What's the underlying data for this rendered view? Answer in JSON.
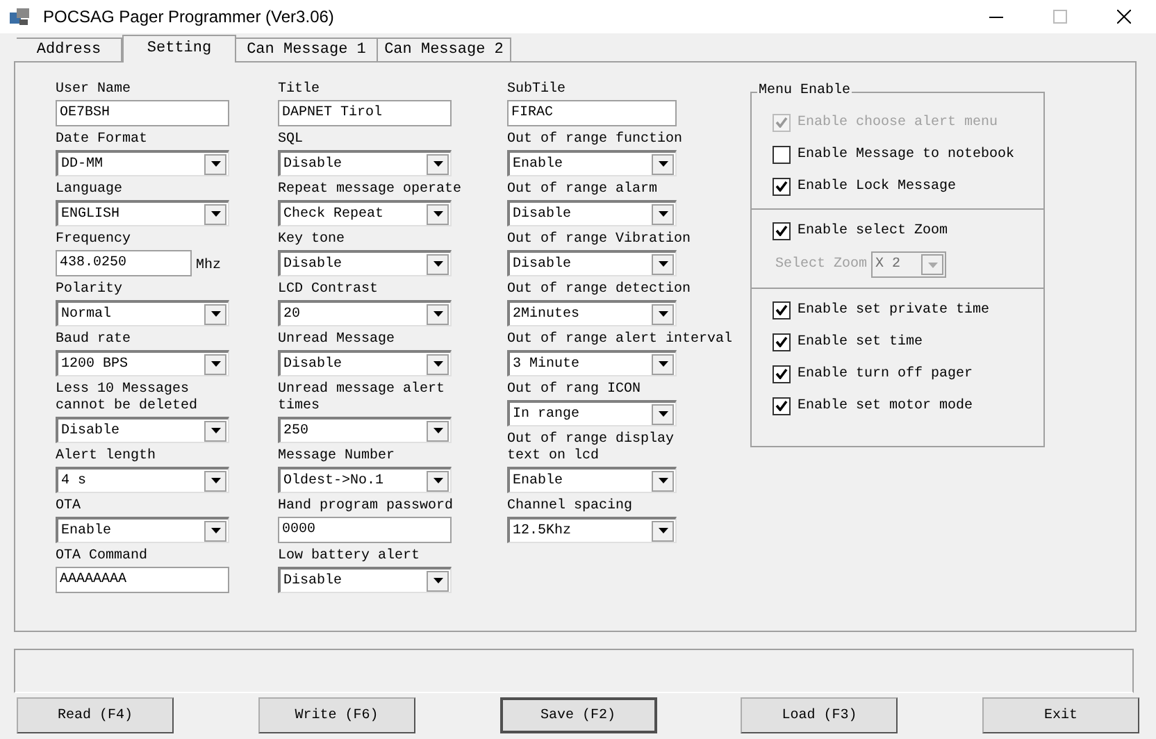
{
  "window": {
    "title": "POCSAG Pager Programmer (Ver3.06)"
  },
  "tabs": [
    {
      "label": "Address",
      "selected": false
    },
    {
      "label": "Setting",
      "selected": true
    },
    {
      "label": "Can Message 1",
      "selected": false
    },
    {
      "label": "Can Message 2",
      "selected": false
    }
  ],
  "columns": [
    {
      "fields": [
        {
          "label": "User Name",
          "kind": "text",
          "value": "OE7BSH"
        },
        {
          "label": "Date Format",
          "kind": "select",
          "value": "DD-MM"
        },
        {
          "label": "Language",
          "kind": "select",
          "value": "ENGLISH"
        },
        {
          "label": "Frequency",
          "kind": "text",
          "value": "438.0250",
          "unit": "Mhz"
        },
        {
          "label": "Polarity",
          "kind": "select",
          "value": "Normal"
        },
        {
          "label": "Baud rate",
          "kind": "select",
          "value": "1200 BPS"
        },
        {
          "label": "Less 10 Messages cannot be deleted",
          "kind": "select",
          "value": "Disable"
        },
        {
          "label": "Alert length",
          "kind": "select",
          "value": "4 s"
        },
        {
          "label": "OTA",
          "kind": "select",
          "value": "Enable"
        },
        {
          "label": "OTA Command",
          "kind": "text",
          "value": "AAAAAAAA"
        }
      ]
    },
    {
      "fields": [
        {
          "label": "Title",
          "kind": "text",
          "value": "DAPNET Tirol"
        },
        {
          "label": "SQL",
          "kind": "select",
          "value": "Disable"
        },
        {
          "label": "Repeat message operate",
          "kind": "select",
          "value": "Check Repeat"
        },
        {
          "label": "Key tone",
          "kind": "select",
          "value": "Disable"
        },
        {
          "label": "LCD Contrast",
          "kind": "select",
          "value": "20"
        },
        {
          "label": "Unread Message",
          "kind": "select",
          "value": "Disable"
        },
        {
          "label": "Unread message alert times",
          "kind": "select",
          "value": "250"
        },
        {
          "label": "Message Number",
          "kind": "select",
          "value": "Oldest->No.1"
        },
        {
          "label": "Hand program password",
          "kind": "text",
          "value": "0000"
        },
        {
          "label": "Low battery alert",
          "kind": "select",
          "value": "Disable"
        }
      ]
    },
    {
      "fields": [
        {
          "label": "SubTile",
          "kind": "text",
          "value": "FIRAC"
        },
        {
          "label": "Out of range function",
          "kind": "select",
          "value": "Enable"
        },
        {
          "label": "Out of range alarm",
          "kind": "select",
          "value": "Disable"
        },
        {
          "label": "Out of range Vibration",
          "kind": "select",
          "value": "Disable"
        },
        {
          "label": "Out of range detection",
          "kind": "select",
          "value": "2Minutes"
        },
        {
          "label": "Out of range alert interval",
          "kind": "select",
          "value": "3 Minute"
        },
        {
          "label": "Out of rang ICON",
          "kind": "select",
          "value": "In range"
        },
        {
          "label": "Out of range display text on lcd",
          "kind": "select",
          "value": "Enable"
        },
        {
          "label": "Channel spacing",
          "kind": "select",
          "value": "12.5Khz"
        }
      ]
    }
  ],
  "menu_enable": {
    "title": "Menu Enable",
    "sections": [
      {
        "items": [
          {
            "kind": "checkbox",
            "label": "Enable choose alert menu",
            "checked": true,
            "disabled": true
          },
          {
            "kind": "checkbox",
            "label": "Enable Message to notebook",
            "checked": false,
            "disabled": false
          },
          {
            "kind": "checkbox",
            "label": "Enable Lock Message",
            "checked": true,
            "disabled": false
          }
        ]
      },
      {
        "items": [
          {
            "kind": "checkbox",
            "label": "Enable select Zoom",
            "checked": true,
            "disabled": false
          },
          {
            "kind": "select",
            "label": "Select Zoom",
            "value": "X 2",
            "disabled": true
          }
        ]
      },
      {
        "items": [
          {
            "kind": "checkbox",
            "label": "Enable set private time",
            "checked": true,
            "disabled": false
          },
          {
            "kind": "checkbox",
            "label": "Enable set time",
            "checked": true,
            "disabled": false
          },
          {
            "kind": "checkbox",
            "label": "Enable turn off pager",
            "checked": true,
            "disabled": false
          },
          {
            "kind": "checkbox",
            "label": "Enable set motor mode",
            "checked": true,
            "disabled": false
          }
        ]
      }
    ]
  },
  "buttons": [
    {
      "label": "Read (F4)",
      "default": false
    },
    {
      "label": "Write (F6)",
      "default": false
    },
    {
      "label": "Save (F2)",
      "default": true
    },
    {
      "label": "Load (F3)",
      "default": false
    },
    {
      "label": "Exit",
      "default": false
    }
  ]
}
